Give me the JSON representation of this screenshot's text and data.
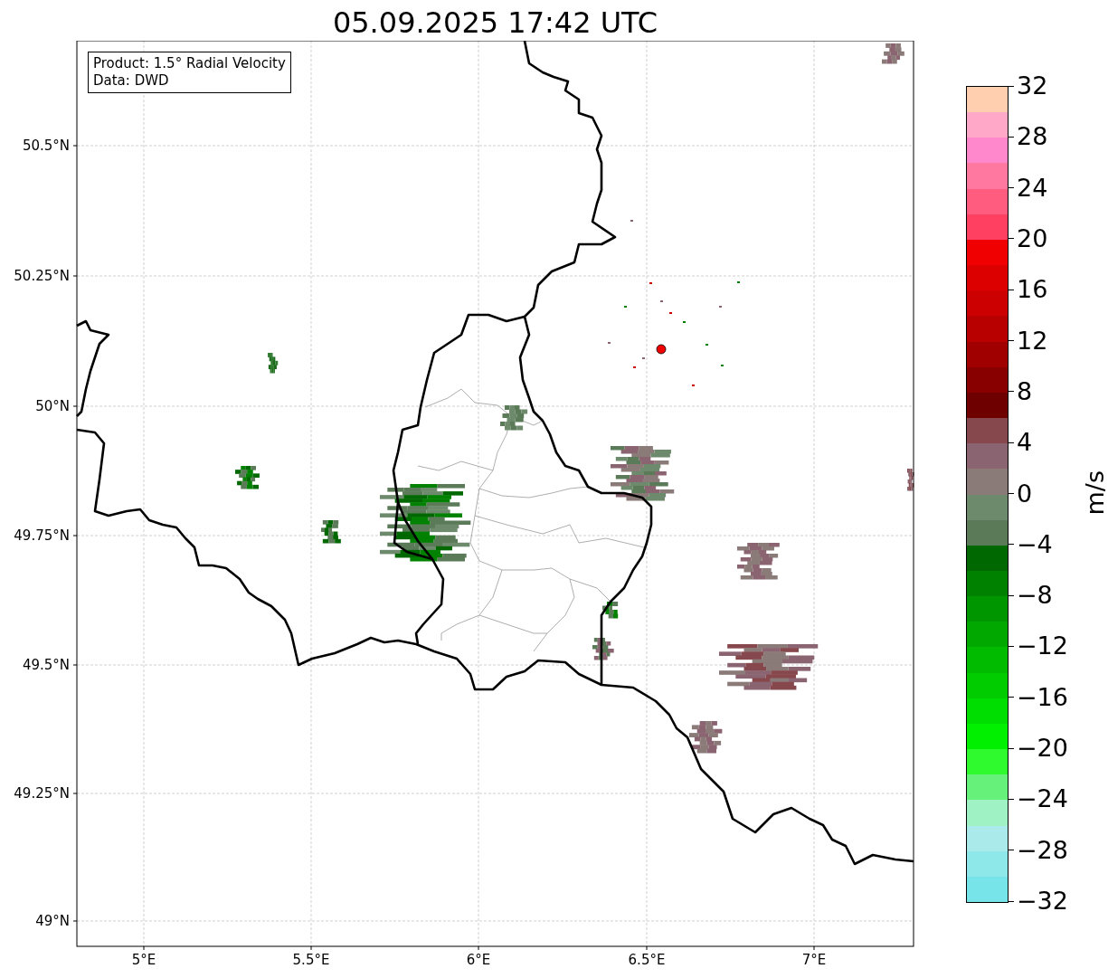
{
  "title": "05.09.2025 17:42 UTC",
  "legend": [
    "Product: 1.5° Radial Velocity",
    "Data: DWD"
  ],
  "map": {
    "y_ticks": [
      "50.5°N",
      "50.25°N",
      "50°N",
      "49.75°N",
      "49.5°N",
      "49.25°N",
      "49°N"
    ],
    "x_ticks": [
      "5°E",
      "5.5°E",
      "6°E",
      "6.5°E",
      "7°E"
    ]
  },
  "colorbar": {
    "label": "m/s",
    "ticks": [
      "32",
      "28",
      "24",
      "20",
      "16",
      "12",
      "8",
      "4",
      "0",
      "−4",
      "−8",
      "−12",
      "−16",
      "−20",
      "−24",
      "−28",
      "−32"
    ]
  }
}
